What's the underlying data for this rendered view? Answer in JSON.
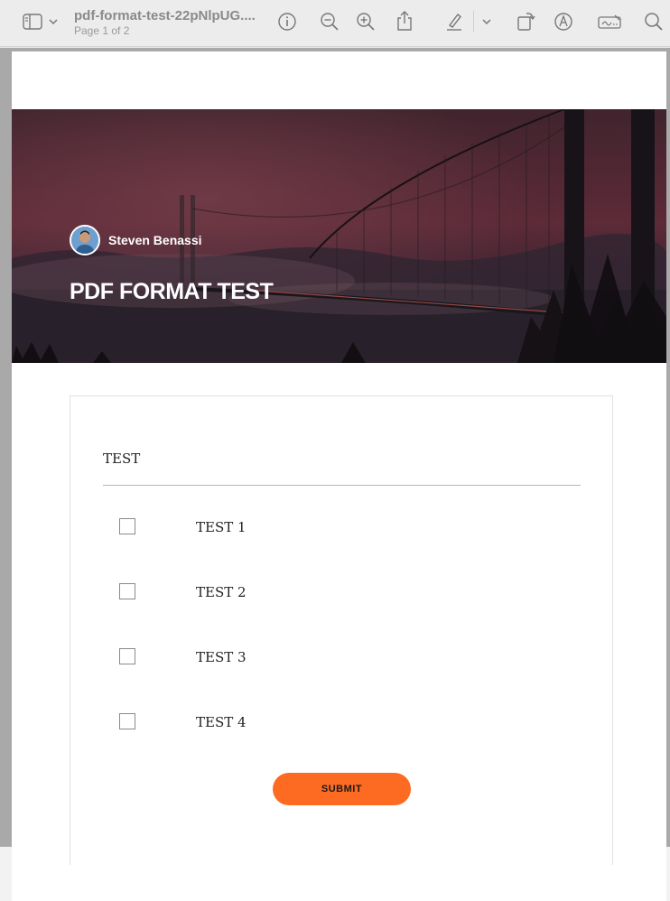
{
  "toolbar": {
    "title": "pdf-format-test-22pNlpUG....",
    "page_indicator": "Page 1 of 2",
    "icons": [
      "sidebar-icon",
      "chevron-down-icon",
      "info-icon",
      "zoom-out-icon",
      "zoom-in-icon",
      "share-icon",
      "highlight-pen-icon",
      "chevron-down-icon",
      "rotate-icon",
      "markup-icon",
      "signature-icon",
      "search-icon"
    ]
  },
  "hero": {
    "author": "Steven Benassi",
    "title": "PDF FORMAT TEST"
  },
  "form": {
    "question": "TEST",
    "options": [
      "TEST 1",
      "TEST 2",
      "TEST 3",
      "TEST 4"
    ],
    "submit_label": "SUBMIT"
  },
  "colors": {
    "accent": "#fd6a22",
    "hero_tint": "#5a2a36"
  }
}
